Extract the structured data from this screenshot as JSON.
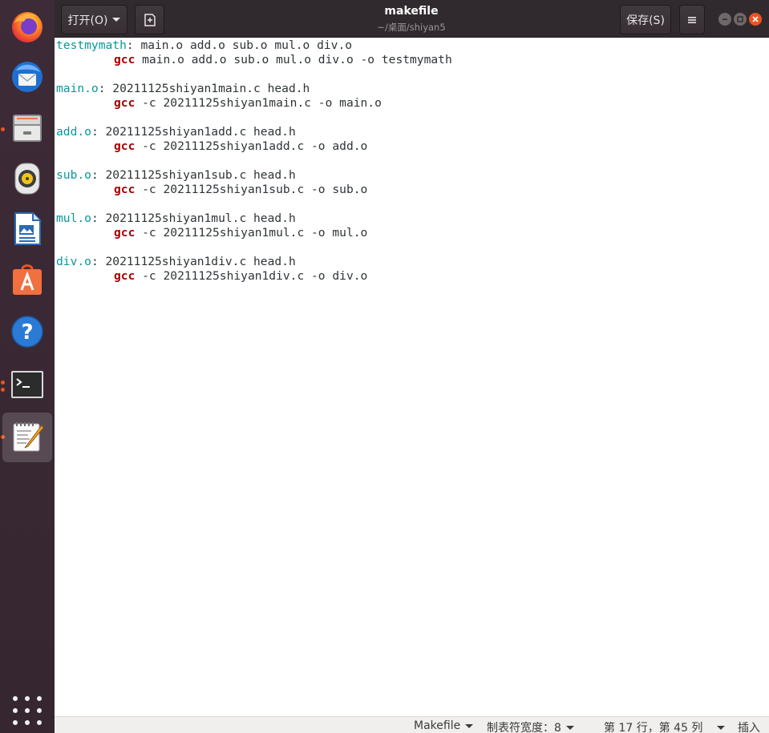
{
  "window": {
    "title": "makefile",
    "subtitle": "~/桌面/shiyan5",
    "open_label": "打开(O)",
    "save_label": "保存(S)"
  },
  "dock": {
    "items": [
      {
        "name": "firefox",
        "running": false,
        "active": false
      },
      {
        "name": "thunderbird",
        "running": false,
        "active": false
      },
      {
        "name": "files",
        "running": true,
        "active": false
      },
      {
        "name": "rhythmbox",
        "running": false,
        "active": false
      },
      {
        "name": "libreoffice-writer",
        "running": false,
        "active": false
      },
      {
        "name": "ubuntu-software",
        "running": false,
        "active": false
      },
      {
        "name": "help",
        "running": false,
        "active": false
      },
      {
        "name": "terminal",
        "running": true,
        "active": false
      },
      {
        "name": "text-editor",
        "running": true,
        "active": true
      }
    ]
  },
  "editor": {
    "lines": [
      {
        "target": "testmymath",
        "deps": ": main.o add.o sub.o mul.o div.o"
      },
      {
        "cmd": "gcc",
        "args": " main.o add.o sub.o mul.o div.o -o testmymath"
      },
      {
        "blank": ""
      },
      {
        "target": "main.o",
        "deps": ": 20211125shiyan1main.c head.h"
      },
      {
        "cmd": "gcc",
        "args": " -c 20211125shiyan1main.c -o main.o"
      },
      {
        "blank": ""
      },
      {
        "target": "add.o",
        "deps": ": 20211125shiyan1add.c head.h"
      },
      {
        "cmd": "gcc",
        "args": " -c 20211125shiyan1add.c -o add.o"
      },
      {
        "blank": ""
      },
      {
        "target": "sub.o",
        "deps": ": 20211125shiyan1sub.c head.h"
      },
      {
        "cmd": "gcc",
        "args": " -c 20211125shiyan1sub.c -o sub.o"
      },
      {
        "blank": ""
      },
      {
        "target": "mul.o",
        "deps": ": 20211125shiyan1mul.c head.h"
      },
      {
        "cmd": "gcc",
        "args": " -c 20211125shiyan1mul.c -o mul.o"
      },
      {
        "blank": ""
      },
      {
        "target": "div.o",
        "deps": ": 20211125shiyan1div.c head.h"
      },
      {
        "cmd": "gcc",
        "args": " -c 20211125shiyan1div.c -o div.o"
      }
    ]
  },
  "status": {
    "language": "Makefile",
    "tab_width": "制表符宽度：8",
    "position": "第 17 行，第 45 列",
    "mode": "插入"
  },
  "colors": {
    "target": "#06989a",
    "keyword": "#a40000",
    "accent": "#e95420"
  }
}
